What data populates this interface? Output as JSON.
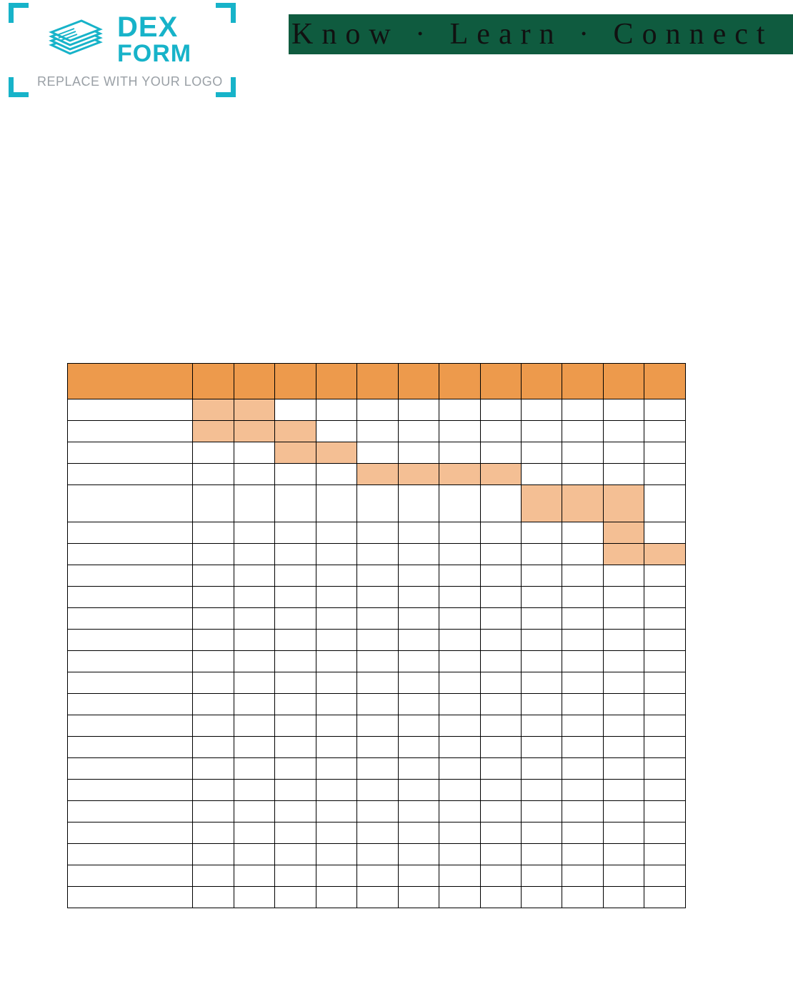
{
  "logo": {
    "brand_top": "DEX",
    "brand_bottom": "FORM",
    "replace_text": "REPLACE WITH YOUR LOGO"
  },
  "banner": {
    "text": "Know · Learn · Connect"
  },
  "chart_data": {
    "type": "table",
    "title": "",
    "columns": [
      "",
      "",
      "",
      "",
      "",
      "",
      "",
      "",
      "",
      "",
      "",
      "",
      ""
    ],
    "rows": [
      {
        "label": "",
        "filled": [
          1,
          2
        ]
      },
      {
        "label": "",
        "filled": [
          1,
          2,
          3
        ]
      },
      {
        "label": "",
        "filled": [
          3,
          4
        ]
      },
      {
        "label": "",
        "filled": [
          5,
          6,
          7,
          8
        ]
      },
      {
        "label": "",
        "filled": [
          9,
          10,
          11
        ],
        "tall": true
      },
      {
        "label": "",
        "filled": [
          11
        ]
      },
      {
        "label": "",
        "filled": [
          11,
          12
        ]
      },
      {
        "label": "",
        "filled": []
      },
      {
        "label": "",
        "filled": []
      },
      {
        "label": "",
        "filled": []
      },
      {
        "label": "",
        "filled": []
      },
      {
        "label": "",
        "filled": []
      },
      {
        "label": "",
        "filled": []
      },
      {
        "label": "",
        "filled": []
      },
      {
        "label": "",
        "filled": []
      },
      {
        "label": "",
        "filled": []
      },
      {
        "label": "",
        "filled": []
      },
      {
        "label": "",
        "filled": []
      },
      {
        "label": "",
        "filled": []
      },
      {
        "label": "",
        "filled": []
      },
      {
        "label": "",
        "filled": []
      },
      {
        "label": "",
        "filled": []
      },
      {
        "label": "",
        "filled": []
      }
    ]
  }
}
